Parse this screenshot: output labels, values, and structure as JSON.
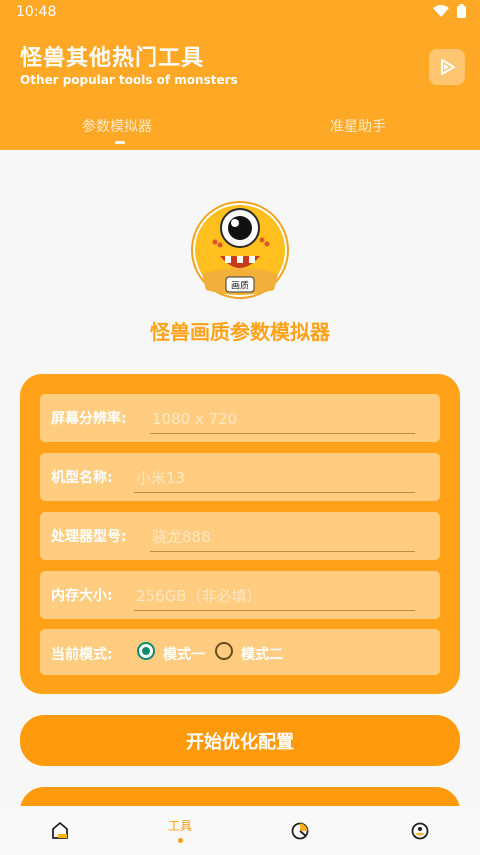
{
  "status_bar": {
    "time": "10:48"
  },
  "header": {
    "title": "怪兽其他热门工具",
    "subtitle": "Other popular tools of monsters"
  },
  "tabs": [
    {
      "label": "参数模拟器",
      "active": true
    },
    {
      "label": "准星助手",
      "active": false
    }
  ],
  "logo": {
    "badge_text": "画质"
  },
  "app_name": "怪兽画质参数模拟器",
  "form": {
    "resolution": {
      "label": "屏幕分辨率:",
      "placeholder": "1080 x 720"
    },
    "model": {
      "label": "机型名称:",
      "placeholder": "小米13"
    },
    "processor": {
      "label": "处理器型号:",
      "placeholder": "骁龙888"
    },
    "memory": {
      "label": "内存大小:",
      "placeholder": "256GB（非必填）"
    },
    "mode": {
      "label": "当前模式:",
      "options": [
        "模式一",
        "模式二"
      ],
      "selected": "模式一"
    }
  },
  "start_button": "开始优化配置",
  "bottom_nav": [
    {
      "icon": "home-icon",
      "label": ""
    },
    {
      "icon": "tools",
      "label": "工具",
      "active": true
    },
    {
      "icon": "chart-icon",
      "label": ""
    },
    {
      "icon": "profile-icon",
      "label": ""
    }
  ],
  "colors": {
    "primary": "#ffa826",
    "button": "#ff9a0c",
    "radio": "#0e8a6e"
  }
}
